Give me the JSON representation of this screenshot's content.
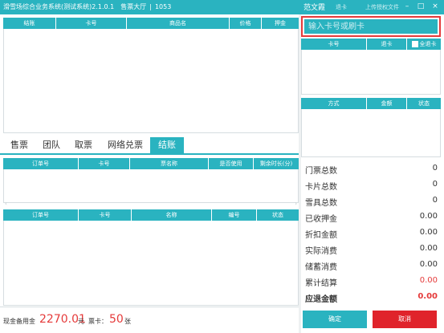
{
  "titlebar": {
    "app_title": "滑雪场综合业务系统(测试系统)2.1.0.1",
    "hall": "售票大厅",
    "number": "1053",
    "user": "范文霞",
    "link_switch": "退卡",
    "link_upload": "上传授权文件",
    "minimize": "–",
    "maximize": "□",
    "close": "×"
  },
  "top_grid": {
    "headers": [
      "结账",
      "卡号",
      "商品名",
      "价格",
      "押金"
    ]
  },
  "right_card": {
    "placeholder": "输入卡号或刷卡",
    "headers": [
      "卡号",
      "退卡",
      "全退卡"
    ]
  },
  "right_pay": {
    "headers": [
      "方式",
      "金额",
      "状态"
    ]
  },
  "tabs": {
    "items": [
      "售票",
      "团队",
      "取票",
      "网络兑票",
      "结账"
    ],
    "active_index": 4
  },
  "order_grid": {
    "headers": [
      "订单号",
      "卡号",
      "票名称",
      "是否使用",
      "剩余时长(分)"
    ]
  },
  "detail_grid": {
    "headers": [
      "订单号",
      "卡号",
      "名称",
      "编号",
      "状态"
    ]
  },
  "summary": [
    {
      "label": "门票总数",
      "value": "0",
      "red": false,
      "bold": false
    },
    {
      "label": "卡片总数",
      "value": "0",
      "red": false,
      "bold": false
    },
    {
      "label": "雪具总数",
      "value": "0",
      "red": false,
      "bold": false
    },
    {
      "label": "已收押金",
      "value": "0.00",
      "red": false,
      "bold": false
    },
    {
      "label": "折扣金额",
      "value": "0.00",
      "red": false,
      "bold": false
    },
    {
      "label": "实际消费",
      "value": "0.00",
      "red": false,
      "bold": false
    },
    {
      "label": "储蓄消费",
      "value": "0.00",
      "red": false,
      "bold": false
    },
    {
      "label": "累计结算",
      "value": "0.00",
      "red": true,
      "bold": false
    },
    {
      "label": "应退金额",
      "value": "0.00",
      "red": true,
      "bold": true
    }
  ],
  "buttons": {
    "confirm": "确定",
    "cancel": "取消"
  },
  "footer": {
    "cash_label": "现金备用金",
    "cash_value": "2270.01",
    "cash_unit": "元",
    "ticket_label": "票卡：",
    "ticket_value": "50",
    "ticket_unit": "张"
  },
  "colors": {
    "accent": "#2ab3c0",
    "danger": "#e0232b",
    "highlight_red": "#e53a3a"
  }
}
